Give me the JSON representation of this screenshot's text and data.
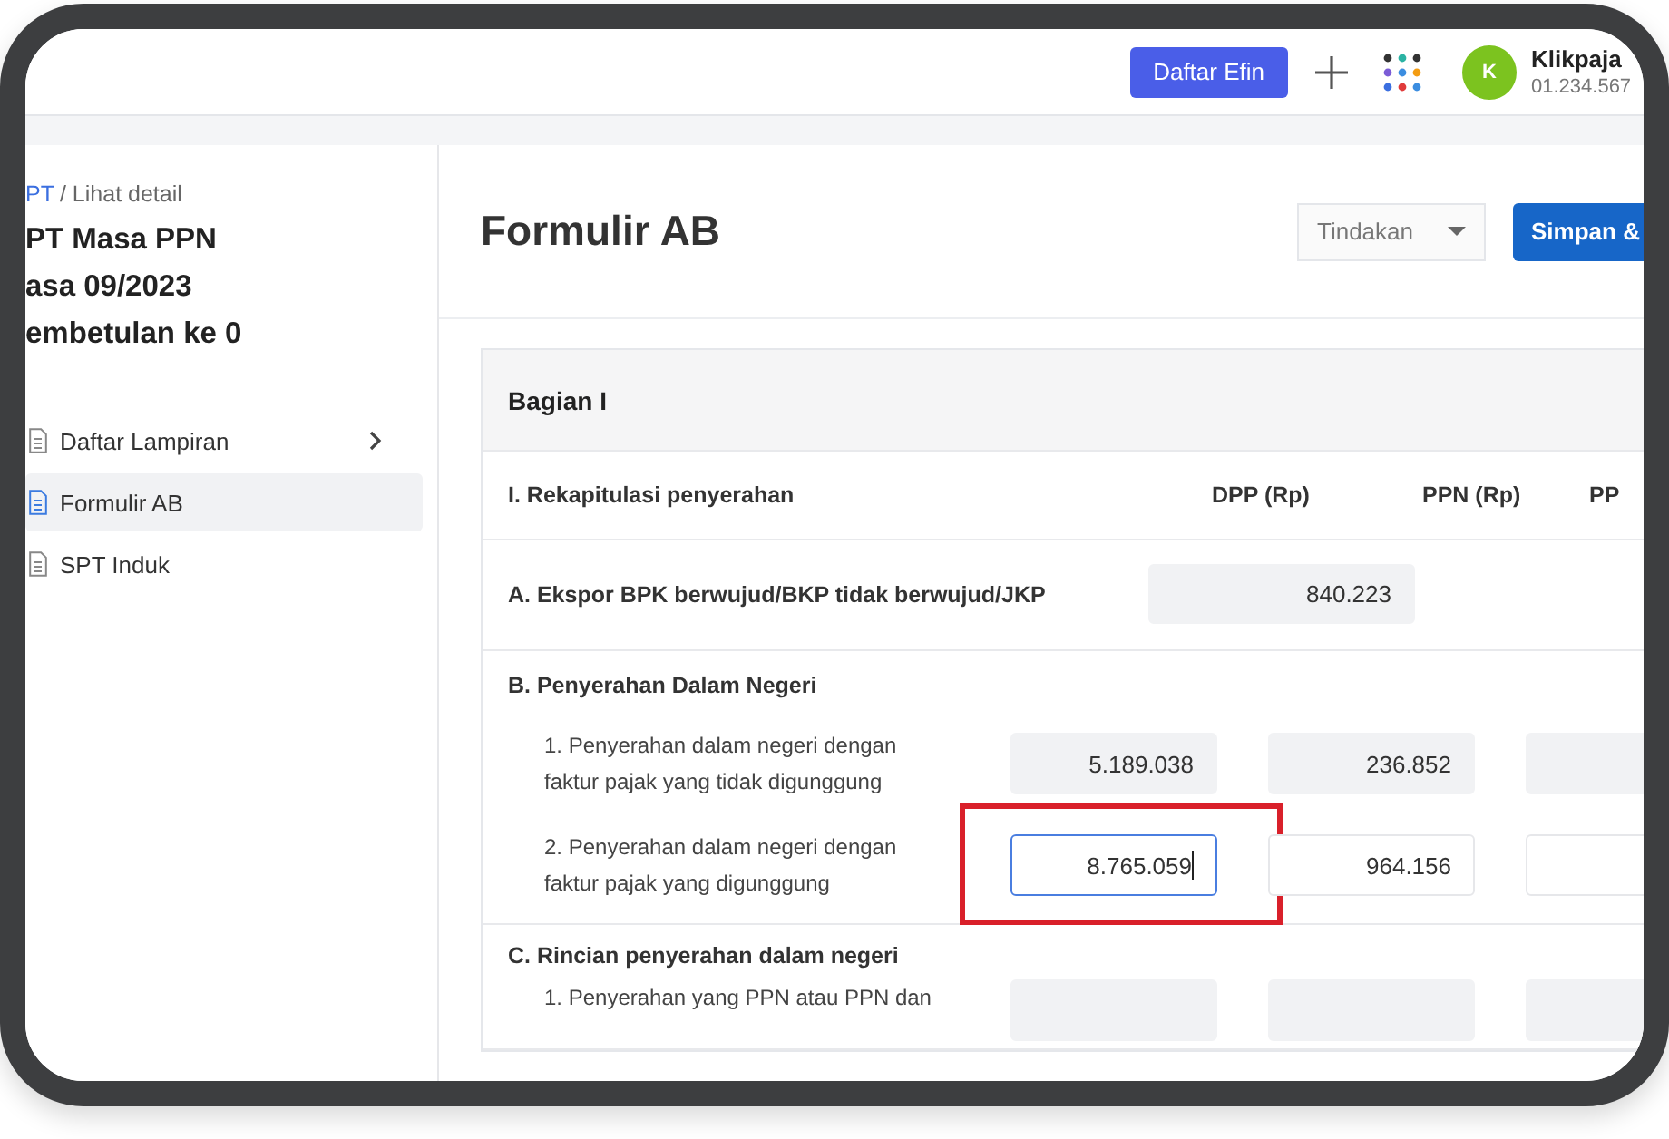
{
  "topbar": {
    "button": "Daftar Efin",
    "avatar_initial": "K",
    "account_name": "Klikpaja",
    "account_id": "01.234.567"
  },
  "sidebar": {
    "breadcrumb": {
      "link": "PT",
      "current": "/ Lihat detail"
    },
    "title_lines": [
      "PT Masa PPN",
      "asa 09/2023",
      "embetulan ke 0"
    ],
    "items": [
      {
        "label": "Daftar Lampiran",
        "selected": false,
        "expandable": true
      },
      {
        "label": "Formulir AB",
        "selected": true,
        "expandable": false
      },
      {
        "label": "SPT Induk",
        "selected": false,
        "expandable": false
      }
    ]
  },
  "page": {
    "title": "Formulir AB",
    "action_select": "Tindakan",
    "primary_button": "Simpan &"
  },
  "section": {
    "title": "Bagian I",
    "header": {
      "label": "I. Rekapitulasi penyerahan",
      "columns": [
        "DPP (Rp)",
        "PPN (Rp)",
        "PP"
      ]
    },
    "groups": [
      {
        "kind": "single",
        "label": "A. Ekspor BPK berwujud/BKP tidak berwujud/JKP",
        "fields": [
          {
            "value": "840.223",
            "disabled": true,
            "focused": false,
            "highlighted": false
          }
        ]
      },
      {
        "kind": "group",
        "label": "B. Penyerahan Dalam Negeri",
        "rows": [
          {
            "label": "1. Penyerahan dalam negeri dengan faktur pajak yang tidak digunggung",
            "fields": [
              {
                "value": "5.189.038",
                "disabled": true,
                "focused": false,
                "highlighted": false
              },
              {
                "value": "236.852",
                "disabled": true,
                "focused": false,
                "highlighted": false
              },
              {
                "disabled": true,
                "focused": false,
                "highlighted": false
              }
            ]
          },
          {
            "label": "2. Penyerahan dalam negeri dengan faktur pajak yang digunggung",
            "fields": [
              {
                "value": "8.765.059",
                "disabled": false,
                "focused": true,
                "highlighted": true
              },
              {
                "value": "964.156",
                "disabled": false,
                "focused": false,
                "highlighted": false
              },
              {
                "disabled": false,
                "focused": false,
                "highlighted": false
              }
            ]
          }
        ]
      },
      {
        "kind": "group",
        "label": "C. Rincian penyerahan dalam negeri",
        "rows": [
          {
            "label": "1. Penyerahan yang PPN atau PPN dan",
            "fields": [
              {
                "disabled": true,
                "focused": false,
                "highlighted": false
              },
              {
                "disabled": true,
                "focused": false,
                "highlighted": false
              },
              {
                "disabled": true,
                "focused": false,
                "highlighted": false
              }
            ]
          }
        ]
      }
    ]
  }
}
